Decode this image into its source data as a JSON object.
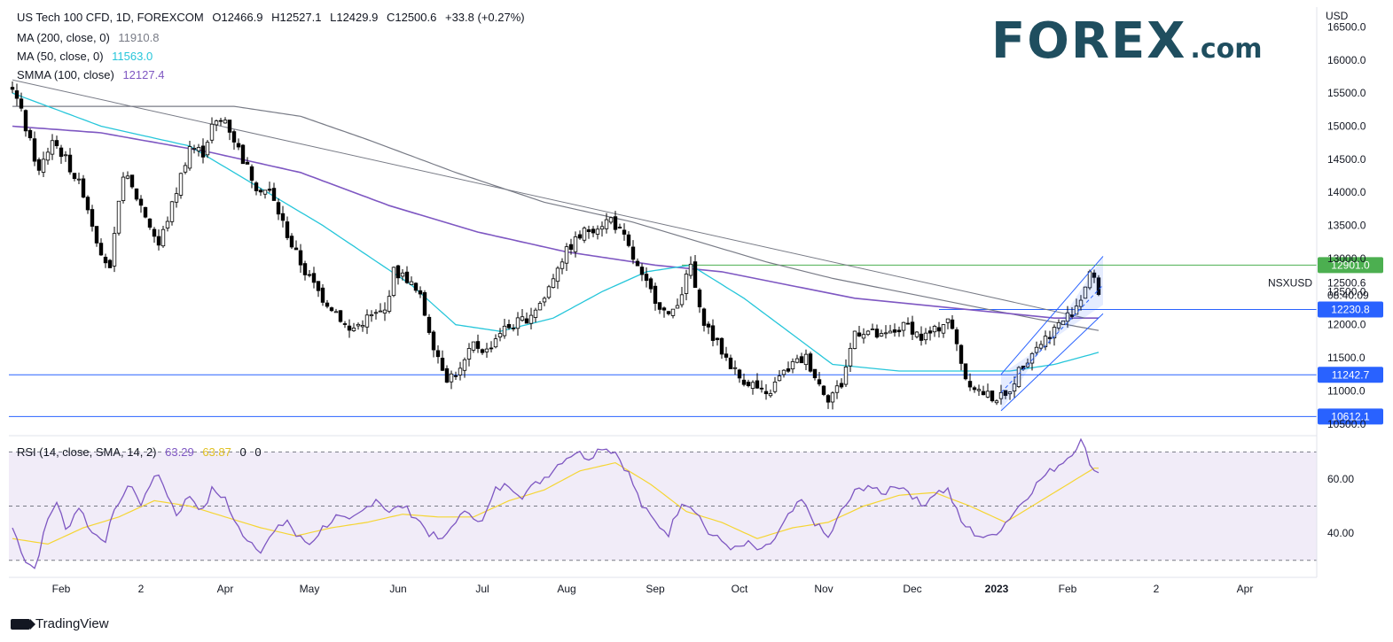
{
  "header": {
    "symbol_line": "US Tech 100 CFD, 1D, FOREXCOM",
    "o_label": "O",
    "o_value": "12466.9",
    "h_label": "H",
    "h_value": "12527.1",
    "l_label": "L",
    "l_value": "12429.9",
    "c_label": "C",
    "c_value": "12500.6",
    "change": "+33.8 (+0.27%)"
  },
  "indicators": {
    "ma200": {
      "label": "MA (200, close, 0)",
      "value": "11910.8",
      "color": "#787b86"
    },
    "ma50": {
      "label": "MA (50, close, 0)",
      "value": "11563.0",
      "color": "#26c6da"
    },
    "smma100": {
      "label": "SMMA (100, close)",
      "value": "12127.4",
      "color": "#7e57c2"
    },
    "rsi": {
      "label": "RSI (14, close, SMA, 14, 2)",
      "value": "63.29",
      "sma_value": "63.87",
      "extra1": "0",
      "extra2": "0",
      "color": "#7e57c2",
      "sma_color": "#f5d533"
    }
  },
  "logo": {
    "main": "FOREX",
    "suffix": ".com"
  },
  "footer": {
    "brand": "TradingView"
  },
  "chart_data": {
    "type": "candlestick",
    "currency": "USD",
    "ticker": "NSXUSD",
    "countdown": "08:40:09",
    "last_price": "12500.6",
    "y_ticks": [
      "16500.0",
      "16000.0",
      "15500.0",
      "15000.0",
      "14500.0",
      "14000.0",
      "13500.0",
      "13000.0",
      "12500.0",
      "12000.0",
      "11500.0",
      "11000.0",
      "10500.0"
    ],
    "x_ticks": [
      "Feb",
      "2",
      "Apr",
      "May",
      "Jun",
      "Jul",
      "Aug",
      "Sep",
      "Oct",
      "Nov",
      "Dec",
      "2023",
      "Feb",
      "2",
      "Apr"
    ],
    "ylim": [
      10350,
      16800
    ],
    "levels": [
      {
        "label": "12901.0",
        "value": 12901.0,
        "color": "#4caf50"
      },
      {
        "label": "12230.8",
        "value": 12230.8,
        "color": "#2962ff"
      },
      {
        "label": "11242.7",
        "value": 11242.7,
        "color": "#2962ff"
      },
      {
        "label": "10612.1",
        "value": 10612.1,
        "color": "#2962ff"
      }
    ],
    "price_anchors": [
      [
        0,
        15600
      ],
      [
        2,
        15200
      ],
      [
        6,
        14300
      ],
      [
        9,
        14800
      ],
      [
        12,
        14500
      ],
      [
        16,
        14000
      ],
      [
        19,
        13300
      ],
      [
        22,
        12800
      ],
      [
        25,
        14300
      ],
      [
        29,
        13800
      ],
      [
        33,
        13200
      ],
      [
        36,
        13800
      ],
      [
        40,
        14700
      ],
      [
        43,
        14600
      ],
      [
        45,
        15000
      ],
      [
        48,
        15100
      ],
      [
        52,
        14500
      ],
      [
        55,
        14100
      ],
      [
        58,
        14000
      ],
      [
        60,
        13700
      ],
      [
        63,
        13200
      ],
      [
        66,
        12800
      ],
      [
        70,
        12400
      ],
      [
        73,
        12200
      ],
      [
        76,
        11900
      ],
      [
        80,
        12100
      ],
      [
        84,
        12200
      ],
      [
        86,
        12800
      ],
      [
        89,
        12700
      ],
      [
        92,
        12400
      ],
      [
        95,
        11700
      ],
      [
        98,
        11200
      ],
      [
        101,
        11300
      ],
      [
        104,
        11700
      ],
      [
        107,
        11600
      ],
      [
        110,
        11900
      ],
      [
        113,
        12000
      ],
      [
        116,
        12100
      ],
      [
        120,
        12400
      ],
      [
        123,
        12900
      ],
      [
        126,
        13200
      ],
      [
        129,
        13400
      ],
      [
        132,
        13500
      ],
      [
        135,
        13600
      ],
      [
        138,
        13300
      ],
      [
        142,
        12700
      ],
      [
        145,
        12400
      ],
      [
        148,
        12100
      ],
      [
        151,
        12500
      ],
      [
        153,
        12900
      ],
      [
        155,
        12200
      ],
      [
        158,
        11800
      ],
      [
        161,
        11500
      ],
      [
        164,
        11200
      ],
      [
        167,
        11100
      ],
      [
        170,
        10900
      ],
      [
        173,
        11200
      ],
      [
        176,
        11400
      ],
      [
        179,
        11500
      ],
      [
        182,
        11100
      ],
      [
        184,
        10900
      ],
      [
        187,
        11100
      ],
      [
        190,
        11900
      ],
      [
        193,
        11900
      ],
      [
        196,
        11800
      ],
      [
        199,
        11900
      ],
      [
        202,
        12000
      ],
      [
        205,
        11800
      ],
      [
        208,
        11900
      ],
      [
        211,
        12100
      ],
      [
        213,
        11700
      ],
      [
        215,
        11200
      ],
      [
        218,
        11000
      ],
      [
        221,
        10900
      ],
      [
        224,
        10900
      ],
      [
        227,
        11300
      ],
      [
        230,
        11600
      ],
      [
        233,
        11800
      ],
      [
        236,
        12000
      ],
      [
        239,
        12200
      ],
      [
        241,
        12400
      ],
      [
        243,
        12800
      ],
      [
        245,
        12500
      ]
    ],
    "ma50_anchors": [
      [
        0,
        15500
      ],
      [
        20,
        15000
      ],
      [
        40,
        14700
      ],
      [
        55,
        14100
      ],
      [
        70,
        13500
      ],
      [
        90,
        12600
      ],
      [
        100,
        12000
      ],
      [
        110,
        11900
      ],
      [
        122,
        12100
      ],
      [
        133,
        12500
      ],
      [
        143,
        12800
      ],
      [
        153,
        12900
      ],
      [
        165,
        12400
      ],
      [
        175,
        11900
      ],
      [
        185,
        11400
      ],
      [
        200,
        11300
      ],
      [
        215,
        11300
      ],
      [
        225,
        11300
      ],
      [
        235,
        11400
      ],
      [
        246,
        11600
      ]
    ],
    "ma200_anchors": [
      [
        0,
        15300
      ],
      [
        15,
        15300
      ],
      [
        30,
        15300
      ],
      [
        50,
        15300
      ],
      [
        65,
        15150
      ],
      [
        80,
        14800
      ],
      [
        100,
        14300
      ],
      [
        120,
        13850
      ],
      [
        140,
        13550
      ],
      [
        155,
        13250
      ],
      [
        170,
        12950
      ],
      [
        185,
        12700
      ],
      [
        200,
        12500
      ],
      [
        215,
        12300
      ],
      [
        230,
        12100
      ],
      [
        246,
        11900
      ]
    ],
    "smma100_anchors": [
      [
        0,
        15000
      ],
      [
        20,
        14900
      ],
      [
        45,
        14600
      ],
      [
        65,
        14300
      ],
      [
        85,
        13800
      ],
      [
        105,
        13400
      ],
      [
        125,
        13100
      ],
      [
        145,
        12900
      ],
      [
        160,
        12800
      ],
      [
        175,
        12600
      ],
      [
        190,
        12400
      ],
      [
        205,
        12300
      ],
      [
        220,
        12200
      ],
      [
        235,
        12100
      ],
      [
        246,
        12100
      ]
    ],
    "rsi": {
      "ylim": [
        25,
        76
      ],
      "upper_band": 70,
      "lower_band": 30,
      "mid_line": 50,
      "tick_labels": [
        "60.00",
        "40.00"
      ],
      "tick_values": [
        60,
        40
      ],
      "anchors": [
        [
          0,
          42
        ],
        [
          3,
          30
        ],
        [
          5,
          27
        ],
        [
          8,
          45
        ],
        [
          10,
          52
        ],
        [
          12,
          41
        ],
        [
          15,
          50
        ],
        [
          18,
          40
        ],
        [
          21,
          38
        ],
        [
          24,
          52
        ],
        [
          27,
          58
        ],
        [
          29,
          50
        ],
        [
          32,
          62
        ],
        [
          34,
          58
        ],
        [
          37,
          47
        ],
        [
          40,
          54
        ],
        [
          43,
          48
        ],
        [
          45,
          56
        ],
        [
          48,
          53
        ],
        [
          50,
          44
        ],
        [
          53,
          38
        ],
        [
          56,
          34
        ],
        [
          59,
          40
        ],
        [
          62,
          45
        ],
        [
          64,
          39
        ],
        [
          67,
          36
        ],
        [
          70,
          42
        ],
        [
          73,
          46
        ],
        [
          76,
          44
        ],
        [
          79,
          48
        ],
        [
          82,
          53
        ],
        [
          85,
          48
        ],
        [
          88,
          50
        ],
        [
          91,
          46
        ],
        [
          94,
          40
        ],
        [
          97,
          37
        ],
        [
          100,
          45
        ],
        [
          103,
          48
        ],
        [
          106,
          44
        ],
        [
          109,
          56
        ],
        [
          112,
          58
        ],
        [
          115,
          54
        ],
        [
          118,
          58
        ],
        [
          121,
          62
        ],
        [
          124,
          67
        ],
        [
          127,
          70
        ],
        [
          130,
          68
        ],
        [
          133,
          72
        ],
        [
          136,
          70
        ],
        [
          139,
          62
        ],
        [
          142,
          50
        ],
        [
          145,
          44
        ],
        [
          148,
          40
        ],
        [
          151,
          52
        ],
        [
          154,
          49
        ],
        [
          157,
          40
        ],
        [
          160,
          37
        ],
        [
          163,
          34
        ],
        [
          166,
          36
        ],
        [
          169,
          33
        ],
        [
          172,
          38
        ],
        [
          175,
          46
        ],
        [
          178,
          52
        ],
        [
          181,
          44
        ],
        [
          184,
          38
        ],
        [
          187,
          48
        ],
        [
          190,
          55
        ],
        [
          193,
          58
        ],
        [
          196,
          54
        ],
        [
          199,
          58
        ],
        [
          202,
          56
        ],
        [
          205,
          50
        ],
        [
          208,
          55
        ],
        [
          211,
          56
        ],
        [
          214,
          44
        ],
        [
          217,
          40
        ],
        [
          220,
          38
        ],
        [
          223,
          42
        ],
        [
          226,
          48
        ],
        [
          229,
          54
        ],
        [
          232,
          60
        ],
        [
          235,
          64
        ],
        [
          238,
          68
        ],
        [
          241,
          74
        ],
        [
          244,
          63
        ]
      ],
      "sma_anchors": [
        [
          0,
          38
        ],
        [
          8,
          36
        ],
        [
          16,
          42
        ],
        [
          24,
          46
        ],
        [
          32,
          52
        ],
        [
          40,
          50
        ],
        [
          48,
          46
        ],
        [
          56,
          42
        ],
        [
          64,
          39
        ],
        [
          72,
          42
        ],
        [
          80,
          44
        ],
        [
          88,
          47
        ],
        [
          96,
          46
        ],
        [
          104,
          46
        ],
        [
          112,
          52
        ],
        [
          120,
          56
        ],
        [
          128,
          63
        ],
        [
          136,
          66
        ],
        [
          144,
          58
        ],
        [
          152,
          48
        ],
        [
          160,
          44
        ],
        [
          168,
          38
        ],
        [
          176,
          42
        ],
        [
          184,
          44
        ],
        [
          192,
          50
        ],
        [
          200,
          54
        ],
        [
          208,
          55
        ],
        [
          216,
          50
        ],
        [
          224,
          44
        ],
        [
          232,
          52
        ],
        [
          240,
          60
        ],
        [
          244,
          64
        ]
      ]
    }
  }
}
